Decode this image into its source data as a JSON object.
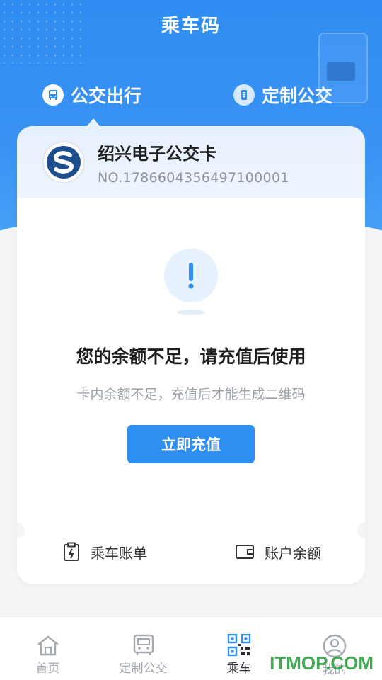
{
  "header": {
    "title": "乘车码"
  },
  "tabs": [
    {
      "label": "公交出行",
      "icon": "bus-icon",
      "active": true
    },
    {
      "label": "定制公交",
      "icon": "ticket-icon",
      "active": false
    }
  ],
  "card": {
    "name": "绍兴电子公交卡",
    "number": "NO.1786604356497100001",
    "logo": "shaoxing-bus-logo"
  },
  "notice": {
    "icon": "exclamation-icon",
    "title": "您的余额不足，请充值后使用",
    "subtitle": "卡内余额不足，充值后才能生成二维码",
    "button_label": "立即充值"
  },
  "card_footer": {
    "bill_label": "乘车账单",
    "balance_label": "账户余额"
  },
  "tabbar": [
    {
      "label": "首页",
      "icon": "home-icon",
      "active": false
    },
    {
      "label": "定制公交",
      "icon": "bus-icon",
      "active": false
    },
    {
      "label": "乘车",
      "icon": "qrcode-icon",
      "active": true
    },
    {
      "label": "我的",
      "icon": "user-icon",
      "active": false
    }
  ],
  "watermark": "ITMOP.COM",
  "colors": {
    "primary": "#2d8ff1",
    "hero": "#3a93f3",
    "text": "#1f1f1f",
    "muted": "#9aa0a8"
  }
}
